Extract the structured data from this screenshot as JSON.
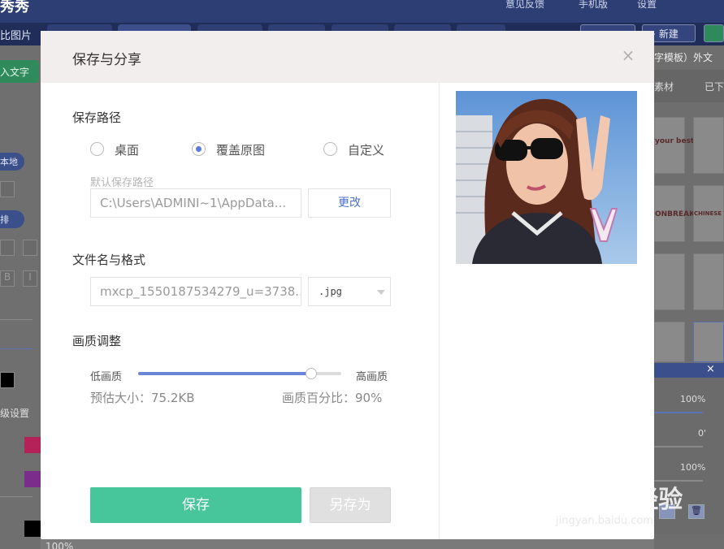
{
  "background_app": {
    "logo": "秀秀",
    "top_right": [
      "意见反馈",
      "手机版",
      "设置"
    ],
    "tab_label": "比图片",
    "new_button": "+ 新建",
    "left_button": "入文字",
    "left_pill_1": "本地",
    "left_pill_2": "排",
    "left_settings": "级设置",
    "left_percent": "100%",
    "right_header": "字模板）外文",
    "right_tab_1": "素材",
    "right_tab_2": "已下",
    "sticker_1": "your best!!!",
    "sticker_2": "ONBREAK",
    "sticker_3": "CHINESE T",
    "popup_values": [
      "100%",
      "0'",
      "100%"
    ]
  },
  "modal": {
    "title": "保存与分享",
    "close_icon": "×",
    "save_path": {
      "label": "保存路径",
      "options": [
        "桌面",
        "覆盖原图",
        "自定义"
      ],
      "selected": "覆盖原图",
      "default_hint": "默认保存路径",
      "path_value": "C:\\Users\\ADMINI~1\\AppData...",
      "change_button": "更改"
    },
    "file": {
      "label": "文件名与格式",
      "filename": "mxcp_1550187534279_u=3738...",
      "format": ".jpg"
    },
    "quality": {
      "label": "画质调整",
      "low_label": "低画质",
      "high_label": "高画质",
      "value_percent": 85,
      "estimate": "预估大小：75.2KB",
      "percent_text": "画质百分比：90%"
    },
    "buttons": {
      "save": "保存",
      "save_as": "另存为"
    }
  },
  "watermark": {
    "main": "Baidu经验",
    "sub": "jingyan.baidu.com"
  }
}
